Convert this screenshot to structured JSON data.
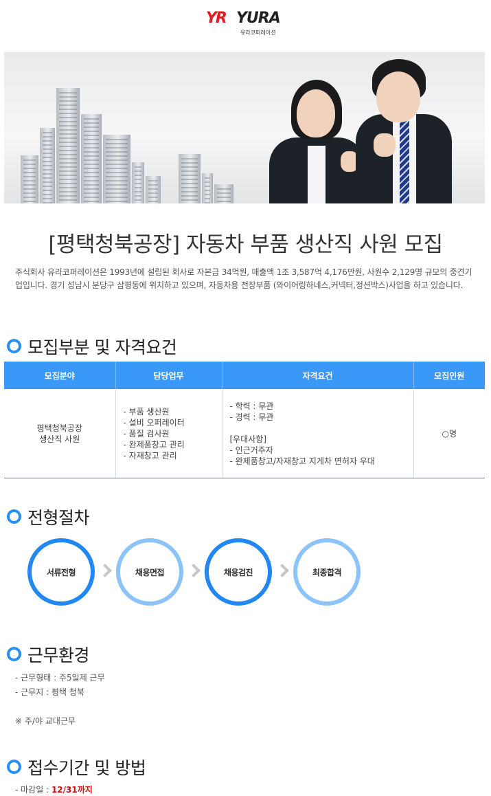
{
  "logo": {
    "mark": "YR",
    "name": "YURA",
    "sub": "유라코퍼레이션"
  },
  "title": "[평택청북공장] 자동차 부품 생산직 사원 모집",
  "intro": "주식회사 유라코퍼레이션은 1993년에 설립된 회사로 자본금 34억원, 매출액 1조 3,587억 4,176만원, 사원수 2,129명 규모의 중견기업입니다. 경기 성남시 분당구 삼평동에 위치하고 있으며, 자동차용 전장부품 (와이어링하네스,커넥터,정션박스)사업을 하고 있습니다.",
  "sections": {
    "recruit": "모집부분 및 자격요건",
    "process": "전형절차",
    "environment": "근무환경",
    "application": "접수기간 및 방법"
  },
  "table": {
    "headers": [
      "모집분야",
      "담당업무",
      "자격요건",
      "모집인원"
    ],
    "field_line1": "평택청북공장",
    "field_line2": "생산직 사원",
    "duties": [
      "부품 생산원",
      "설비 오퍼레이터",
      "품질 검사원",
      "완제품창고 관리",
      "자재창고 관리"
    ],
    "qual_lines": [
      "- 학력 : 무관",
      "- 경력 : 무관",
      "",
      "[우대사항]",
      "- 인근거주자",
      "- 완제품창고/자재창고 지게차 면허자 우대"
    ],
    "headcount": "○명"
  },
  "process_steps": [
    "서류전형",
    "채용면접",
    "채용검진",
    "최종합격"
  ],
  "environment": {
    "type": "-  근무형태 : 주5일제 근무",
    "location": "-  근무지 : 평택 청북",
    "note": "※ 주/야 교대근무"
  },
  "deadline": {
    "label": "-  마감일 : ",
    "value": "12/31까지"
  },
  "colors": {
    "accent": "#2a8ff5",
    "header": "#3a98f8",
    "deadline": "#d20f0f"
  }
}
